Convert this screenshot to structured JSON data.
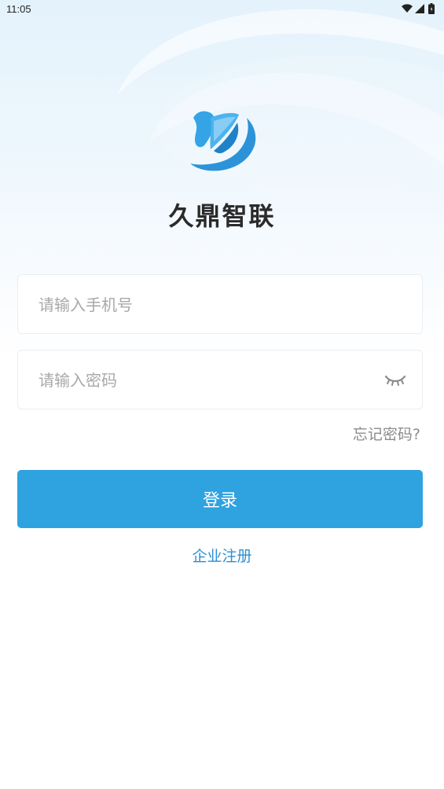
{
  "status_bar": {
    "time": "11:05",
    "icons": [
      "wifi-icon",
      "signal-icon",
      "battery-icon"
    ]
  },
  "app": {
    "name": "久鼎智联",
    "logo_icon": "butterfly-logo-icon"
  },
  "login_form": {
    "phone_placeholder": "请输入手机号",
    "phone_value": "",
    "password_placeholder": "请输入密码",
    "password_value": "",
    "password_toggle_icon": "eye-closed-icon",
    "forgot_password_label": "忘记密码?",
    "login_button_label": "登录",
    "register_link_label": "企业注册"
  },
  "colors": {
    "primary": "#2fa2e0",
    "link": "#2c8fd0",
    "title": "#2b2b2b",
    "placeholder": "#a8a8a8",
    "background_top": "#e4f2fc"
  }
}
